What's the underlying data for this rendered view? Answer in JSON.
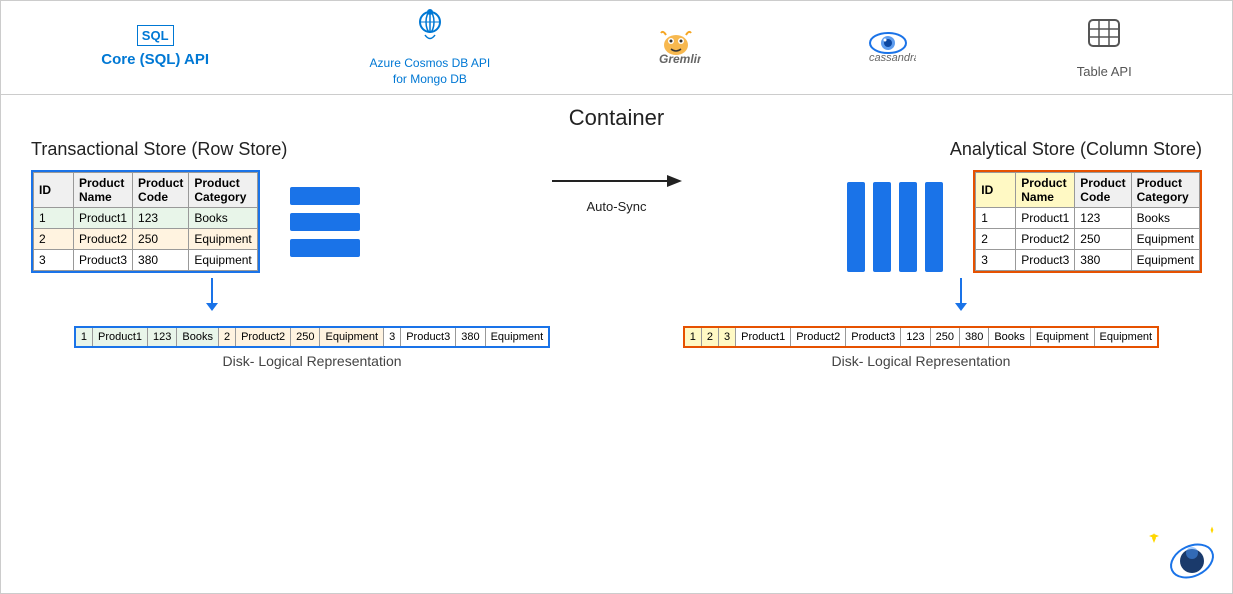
{
  "nav": {
    "items": [
      {
        "id": "sql",
        "label": "Core (SQL) API",
        "icon": "sql-icon"
      },
      {
        "id": "mongo",
        "label": "Azure Cosmos DB API\nfor Mongo DB",
        "icon": "mongo-icon"
      },
      {
        "id": "gremlin",
        "label": "Gremlin",
        "icon": "gremlin-icon"
      },
      {
        "id": "cassandra",
        "label": "cassandra",
        "icon": "cassandra-icon"
      },
      {
        "id": "table",
        "label": "Table API",
        "icon": "table-icon"
      }
    ]
  },
  "main": {
    "container_title": "Container",
    "transactional_title": "Transactional Store (Row Store)",
    "analytical_title": "Analytical Store (Column Store)",
    "sync_label": "Auto-Sync",
    "disk_label": "Disk- Logical Representation",
    "table_headers": [
      "ID",
      "Product\nName",
      "Product\nCode",
      "Product\nCategory"
    ],
    "table_rows": [
      {
        "id": "1",
        "name": "Product1",
        "code": "123",
        "category": "Books"
      },
      {
        "id": "2",
        "name": "Product2",
        "code": "250",
        "category": "Equipment"
      },
      {
        "id": "3",
        "name": "Product3",
        "code": "380",
        "category": "Equipment"
      }
    ],
    "disk_row_transactional": [
      {
        "val": "1",
        "type": "green"
      },
      {
        "val": "Product1",
        "type": "green"
      },
      {
        "val": "123",
        "type": "green"
      },
      {
        "val": "Books",
        "type": "green"
      },
      {
        "val": "2",
        "type": "orange"
      },
      {
        "val": "Product2",
        "type": "orange"
      },
      {
        "val": "250",
        "type": "orange"
      },
      {
        "val": "Equipment",
        "type": "orange"
      },
      {
        "val": "3",
        "type": "plain"
      },
      {
        "val": "Product3",
        "type": "plain"
      },
      {
        "val": "380",
        "type": "plain"
      },
      {
        "val": "Equipment",
        "type": "plain"
      }
    ],
    "disk_row_analytical_ids": [
      "1",
      "2",
      "3"
    ],
    "disk_row_analytical_names": [
      "Product1",
      "Product2",
      "Product3"
    ],
    "disk_row_analytical_codes": [
      "123",
      "250",
      "380"
    ],
    "disk_row_analytical_categories": [
      "Books",
      "Equipment",
      "Equipment"
    ]
  }
}
